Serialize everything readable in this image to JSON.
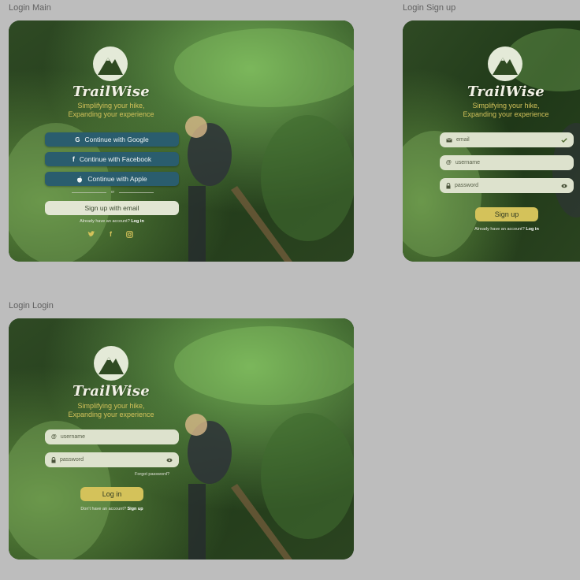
{
  "frames": {
    "main": {
      "label": "Login Main",
      "brand": "TrailWise",
      "tagline_1": "Simplifying your hike,",
      "tagline_2": "Expanding your experience",
      "google_label": "Continue with Google",
      "facebook_label": "Continue with Facebook",
      "apple_label": "Continue with Apple",
      "or_label": "or",
      "email_signup_label": "Sign up with email",
      "already_text": "Already have an account?",
      "login_link": "Log in"
    },
    "signup": {
      "label": "Login Sign up",
      "brand": "TrailWise",
      "tagline_1": "Simplifying your hike,",
      "tagline_2": "Expanding your experience",
      "email_placeholder": "email",
      "username_placeholder": "username",
      "password_placeholder": "password",
      "submit_label": "Sign up",
      "already_text": "Already have an account?",
      "login_link": "Log in"
    },
    "login": {
      "label": "Login Login",
      "brand": "TrailWise",
      "tagline_1": "Simplifying your hike,",
      "tagline_2": "Expanding your experience",
      "username_placeholder": "username",
      "password_placeholder": "password",
      "forgot_label": "Forgot password?",
      "submit_label": "Log in",
      "no_account_text": "Don't have an account?",
      "signup_link": "Sign up"
    }
  },
  "icons": {
    "google": "google-icon",
    "facebook": "facebook-icon",
    "apple": "apple-icon",
    "twitter": "twitter-icon",
    "instagram": "instagram-icon",
    "mail": "mail-icon",
    "at": "at-icon",
    "lock": "lock-icon",
    "eye": "eye-icon",
    "check": "check-icon",
    "mountain": "mountain-icon"
  },
  "colors": {
    "background": "#bdbdbd",
    "button_dark": "#2a5d6e",
    "button_light": "#e2e6d3",
    "accent_yellow": "#d4c25a",
    "forest_dark": "#1e3318",
    "forest_light": "#4f8a3a"
  }
}
